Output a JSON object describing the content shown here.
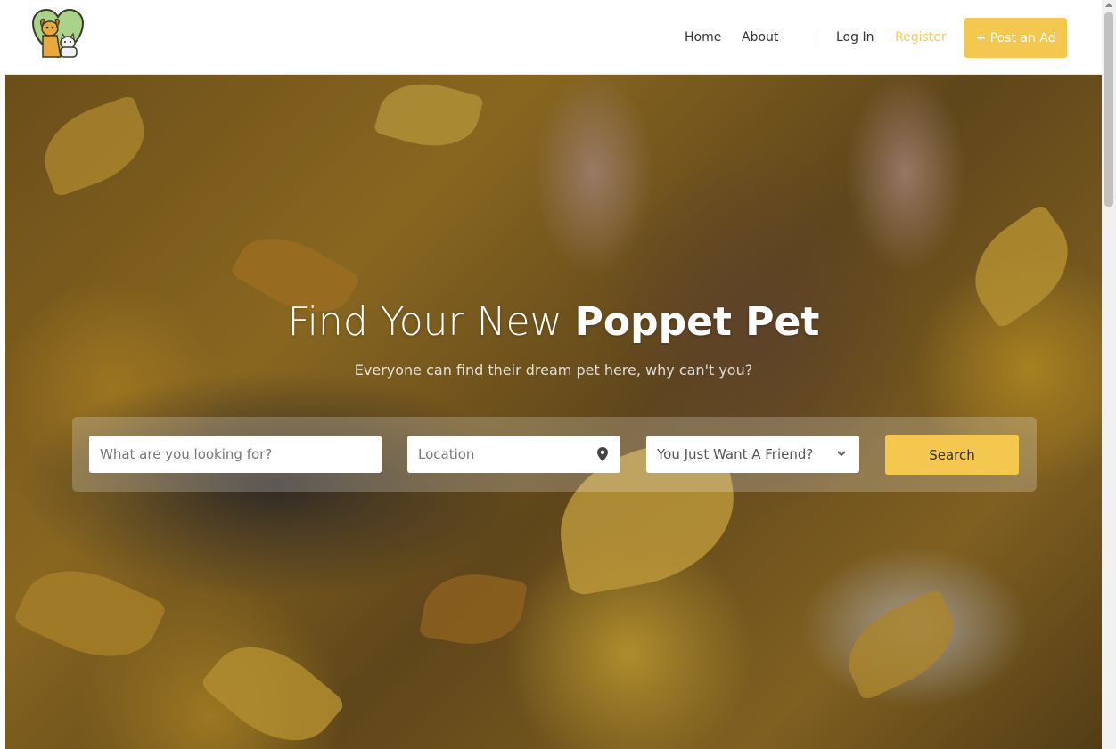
{
  "header": {
    "logo_icon": "dog-and-cat-heart-logo",
    "nav": {
      "home": "Home",
      "about": "About",
      "login": "Log In",
      "register": "Register"
    },
    "post_ad_label": "+ Post an Ad"
  },
  "hero": {
    "title_light": "Find Your New ",
    "title_bold": "Poppet Pet",
    "subtitle": "Everyone can find their dream pet here, why can't you?"
  },
  "search": {
    "what_placeholder": "What are you looking for?",
    "location_placeholder": "Location",
    "location_icon": "map-pin-icon",
    "type_selected": "You Just Want A Friend?",
    "type_icon": "chevron-down-icon",
    "button_label": "Search"
  },
  "colors": {
    "accent": "#f4c84e",
    "register_link": "#f1cd5f"
  }
}
